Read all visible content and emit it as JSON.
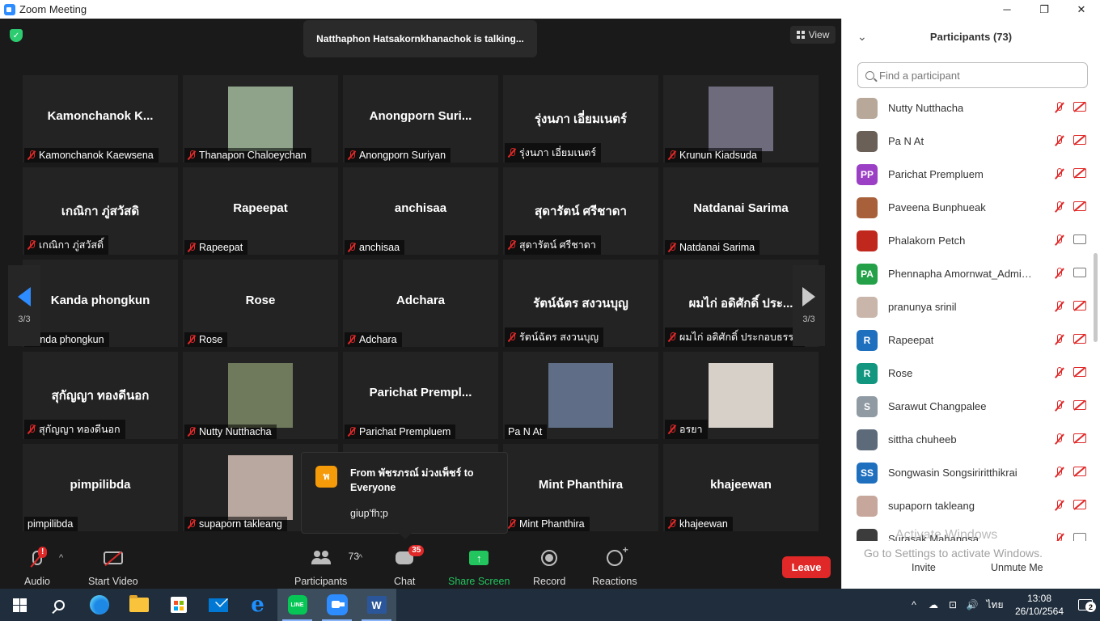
{
  "window": {
    "title": "Zoom Meeting",
    "minimize": "─",
    "maximize": "❐",
    "close": "✕"
  },
  "meeting": {
    "talking": "Natthaphon Hatsakornkhanachok is talking...",
    "view_label": "View",
    "page_left": "3/3",
    "page_right": "3/3",
    "tiles": [
      {
        "big": "Kamonchanok  K...",
        "label": "Kamonchanok Kaewsena",
        "muted": true,
        "video": false
      },
      {
        "big": "",
        "label": "Thanapon Chaloeychan",
        "muted": true,
        "video": true,
        "photo_color": "#8fa38a"
      },
      {
        "big": "Anongporn  Suri...",
        "label": "Anongporn Suriyan",
        "muted": true,
        "video": false
      },
      {
        "big": "รุ่งนภา เอี่ยมเนตร์",
        "label": "รุ่งนภา เอี่ยมเนตร์",
        "muted": true,
        "video": false
      },
      {
        "big": "",
        "label": "Krunun Kiadsuda",
        "muted": true,
        "video": true,
        "photo_color": "#6d6b7c"
      },
      {
        "big": "เกณิกา ภู่สวัสดิ",
        "label": "เกณิกา ภู่สวัสดิ์",
        "muted": true,
        "video": false
      },
      {
        "big": "Rapeepat",
        "label": "Rapeepat",
        "muted": true,
        "video": false
      },
      {
        "big": "anchisaa",
        "label": "anchisaa",
        "muted": true,
        "video": false
      },
      {
        "big": "สุดารัตน์ ศรีชาดา",
        "label": "สุดารัตน์ ศรีชาดา",
        "muted": true,
        "video": false
      },
      {
        "big": "Natdanai Sarima",
        "label": "Natdanai Sarima",
        "muted": true,
        "video": false
      },
      {
        "big": "Kanda phongkun",
        "label": "Kanda phongkun",
        "muted": false,
        "video": false
      },
      {
        "big": "Rose",
        "label": "Rose",
        "muted": true,
        "video": false
      },
      {
        "big": "Adchara",
        "label": "Adchara",
        "muted": true,
        "video": false
      },
      {
        "big": "รัตน์ฉัตร สงวนบุญ",
        "label": "รัตน์ฉัตร สงวนบุญ",
        "muted": true,
        "video": false
      },
      {
        "big": "ผมไก่ อดิศักดิ์ ประ...",
        "label": "ผมไก่ อดิศักดิ์ ประกอบธรรม",
        "muted": true,
        "video": false
      },
      {
        "big": "สุกัญญา ทองดีนอก",
        "label": "สุกัญญา ทองดีนอก",
        "muted": true,
        "video": false
      },
      {
        "big": "",
        "label": "Nutty Nutthacha",
        "muted": true,
        "video": true,
        "photo_color": "#6f7a5c"
      },
      {
        "big": "Parichat  Prempl...",
        "label": "Parichat Prempluem",
        "muted": true,
        "video": false
      },
      {
        "big": "",
        "label": "Pa N At",
        "muted": false,
        "video": true,
        "photo_color": "#5f6d86"
      },
      {
        "big": "",
        "label": "อรยา",
        "muted": true,
        "video": true,
        "photo_color": "#d7d0c9"
      },
      {
        "big": "pimpilibda",
        "label": "pimpilibda",
        "muted": false,
        "video": false
      },
      {
        "big": "",
        "label": "supaporn takleang",
        "muted": true,
        "video": true,
        "photo_color": "#b9a8a0"
      },
      {
        "big": "",
        "label": "",
        "muted": false,
        "video": false
      },
      {
        "big": "Mint Phanthira",
        "label": "Mint Phanthira",
        "muted": true,
        "video": false
      },
      {
        "big": "khajeewan",
        "label": "khajeewan",
        "muted": true,
        "video": false
      }
    ]
  },
  "chat_popup": {
    "avatar": "พ",
    "from": "From พัชรภรณ์ ม่วงเพ็ชร์ to Everyone",
    "message": "giup'fh;p"
  },
  "toolbar": {
    "audio": "Audio",
    "audio_badge": "!",
    "video": "Start Video",
    "participants": "Participants",
    "participants_count": "73",
    "chat": "Chat",
    "chat_badge": "35",
    "share": "Share Screen",
    "share_glyph": "↑",
    "record": "Record",
    "reactions": "Reactions",
    "leave": "Leave",
    "caret": "^"
  },
  "panel": {
    "title": "Participants (73)",
    "collapse_glyph": "⌄",
    "search_placeholder": "Find a participant",
    "participants": [
      {
        "name": "Nutty Nutthacha",
        "initials": "",
        "color": "#b8a89a",
        "cam_on": false
      },
      {
        "name": "Pa N At",
        "initials": "",
        "color": "#6a6058",
        "cam_on": false
      },
      {
        "name": "Parichat Prempluem",
        "initials": "PP",
        "color": "#9b40c4",
        "cam_on": false
      },
      {
        "name": "Paveena Bunphueak",
        "initials": "",
        "color": "#a8603a",
        "cam_on": false
      },
      {
        "name": "Phalakorn Petch",
        "initials": "",
        "color": "#c0281e",
        "cam_on": true
      },
      {
        "name": "Phennapha Amornwat_Admin_T...",
        "initials": "PA",
        "color": "#24a148",
        "cam_on": true
      },
      {
        "name": "pranunya srinil",
        "initials": "",
        "color": "#c9b5aa",
        "cam_on": false
      },
      {
        "name": "Rapeepat",
        "initials": "R",
        "color": "#1f6fbf",
        "cam_on": false
      },
      {
        "name": "Rose",
        "initials": "R",
        "color": "#12967f",
        "cam_on": false
      },
      {
        "name": "Sarawut Changpalee",
        "initials": "S",
        "color": "#8f9aa3",
        "cam_on": false
      },
      {
        "name": "sittha chuheeb",
        "initials": "",
        "color": "#5c6a7a",
        "cam_on": false
      },
      {
        "name": "Songwasin Songsiriritthikrai",
        "initials": "SS",
        "color": "#1f6fbf",
        "cam_on": false
      },
      {
        "name": "supaporn takleang",
        "initials": "",
        "color": "#c7a79c",
        "cam_on": false
      },
      {
        "name": "Surasak Mahangsa",
        "initials": "",
        "color": "#3c3c3c",
        "cam_on": true
      }
    ],
    "watermark_title": "Activate Windows",
    "watermark_sub": "Go to Settings to activate Windows.",
    "invite": "Invite",
    "unmute_me": "Unmute Me"
  },
  "taskbar": {
    "line_label": "LINE",
    "word_label": "W",
    "ie_label": "e",
    "tray_caret": "^",
    "tray_onedrive": "☁",
    "tray_network": "⊡",
    "tray_volume": "🔊",
    "language": "ไทย",
    "time": "13:08",
    "date": "26/10/2564",
    "notifications": "2"
  }
}
